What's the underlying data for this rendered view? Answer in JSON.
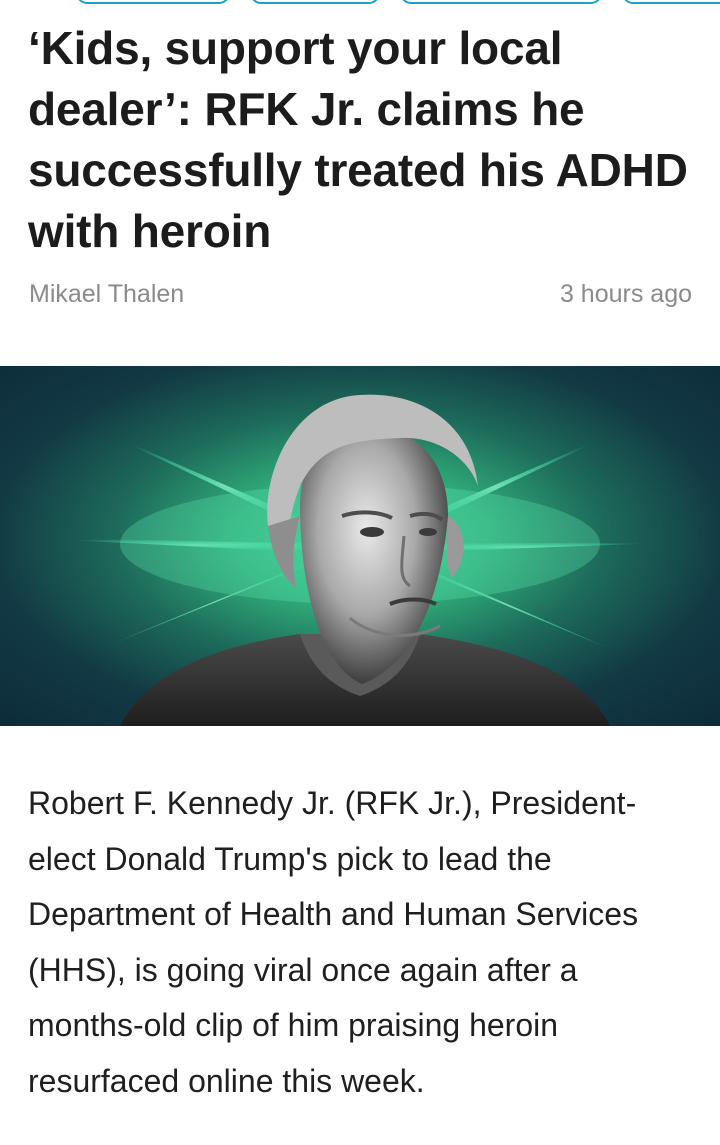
{
  "article": {
    "headline": "‘Kids, support your local dealer’: RFK Jr. claims he successfully treated his ADHD with heroin",
    "author": "Mikael Thalen",
    "timestamp": "3 hours ago",
    "body": "Robert F. Kennedy Jr. (RFK Jr.), President-elect Donald Trump's pick to lead the Department of Health and Human Services (HHS), is going viral once again after a months-old clip of him praising heroin resurfaced online this week."
  },
  "colors": {
    "hero_glow": "#3fd79b",
    "hero_dark": "#0d2b39",
    "chip_border": "#1aa3c8",
    "meta_text": "#8a8a8a"
  }
}
